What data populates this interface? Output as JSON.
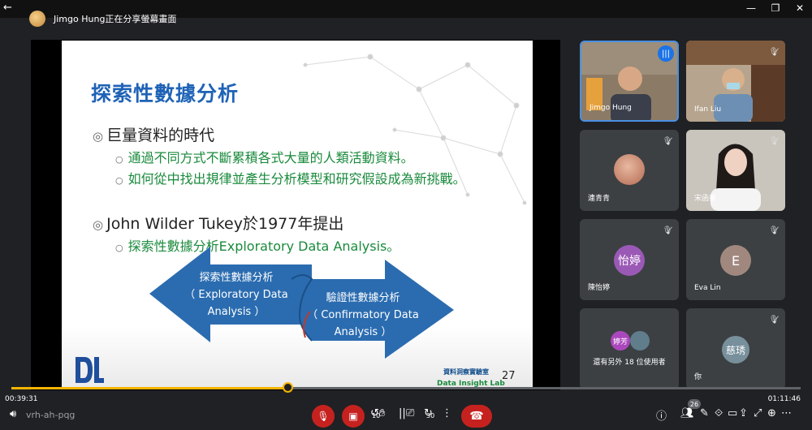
{
  "window": {
    "back": "←",
    "minimize": "—",
    "maximize": "❐",
    "close": "✕"
  },
  "share": {
    "text": "Jimgo Hung正在分享螢幕畫面"
  },
  "slide": {
    "title": "探索性數據分析",
    "bullet1": "巨量資料的時代",
    "bullet1_sub": [
      "通過不同方式不斷累積各式大量的人類活動資料。",
      "如何從中找出規律並產生分析模型和研究假設成為新挑戰。"
    ],
    "bullet2": "John Wilder Tukey於1977年提出",
    "bullet2_sub": "探索性數據分析Exploratory Data Analysis。",
    "arrow_left": [
      "探索性數據分析",
      "（ Exploratory Data",
      "Analysis ）"
    ],
    "arrow_right": [
      "驗證性數據分析",
      "（ Confirmatory Data",
      "Analysis ）"
    ],
    "lab_zh": "資料洞察實驗室",
    "lab_en": "Data Insight Lab",
    "page": "27"
  },
  "participants": [
    {
      "name": "Jimgo Hung",
      "speaking": true
    },
    {
      "name": "Ifan Liu"
    },
    {
      "name": "連青青"
    },
    {
      "name": "宋函蓁"
    },
    {
      "name": "陳怡婷",
      "initials": "怡婷"
    },
    {
      "name": "Eva Lin",
      "initials": "E"
    },
    {
      "name": "還有另外 18 位使用者",
      "initials": "婷芳"
    },
    {
      "name": "你",
      "initials": "慈琇"
    }
  ],
  "player": {
    "elapsed": "00:39:31",
    "total": "01:11:46",
    "progress": 0.35
  },
  "bottom": {
    "meeting_code": "vrh-ah-pqg",
    "rewind": "10",
    "forward": "30",
    "people_count": "26"
  }
}
